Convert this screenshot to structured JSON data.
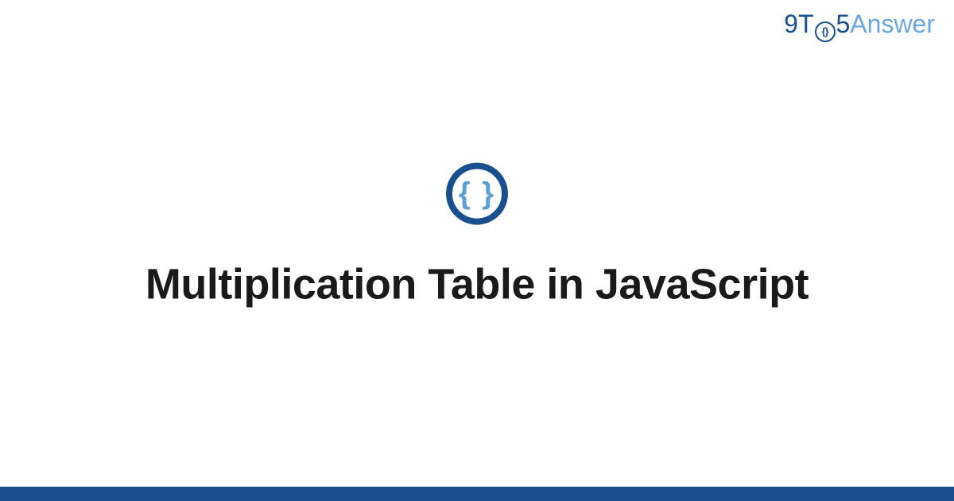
{
  "brand": {
    "part1": "9T",
    "o_inner": "{}",
    "part2": "5",
    "part3": "Answer"
  },
  "icon": {
    "braces": "{ }",
    "semantic": "code-braces-icon"
  },
  "title": "Multiplication Table in JavaScript",
  "colors": {
    "primary": "#1a4f8f",
    "accent": "#5a9fd4",
    "light_blue": "#6ca5e0"
  }
}
